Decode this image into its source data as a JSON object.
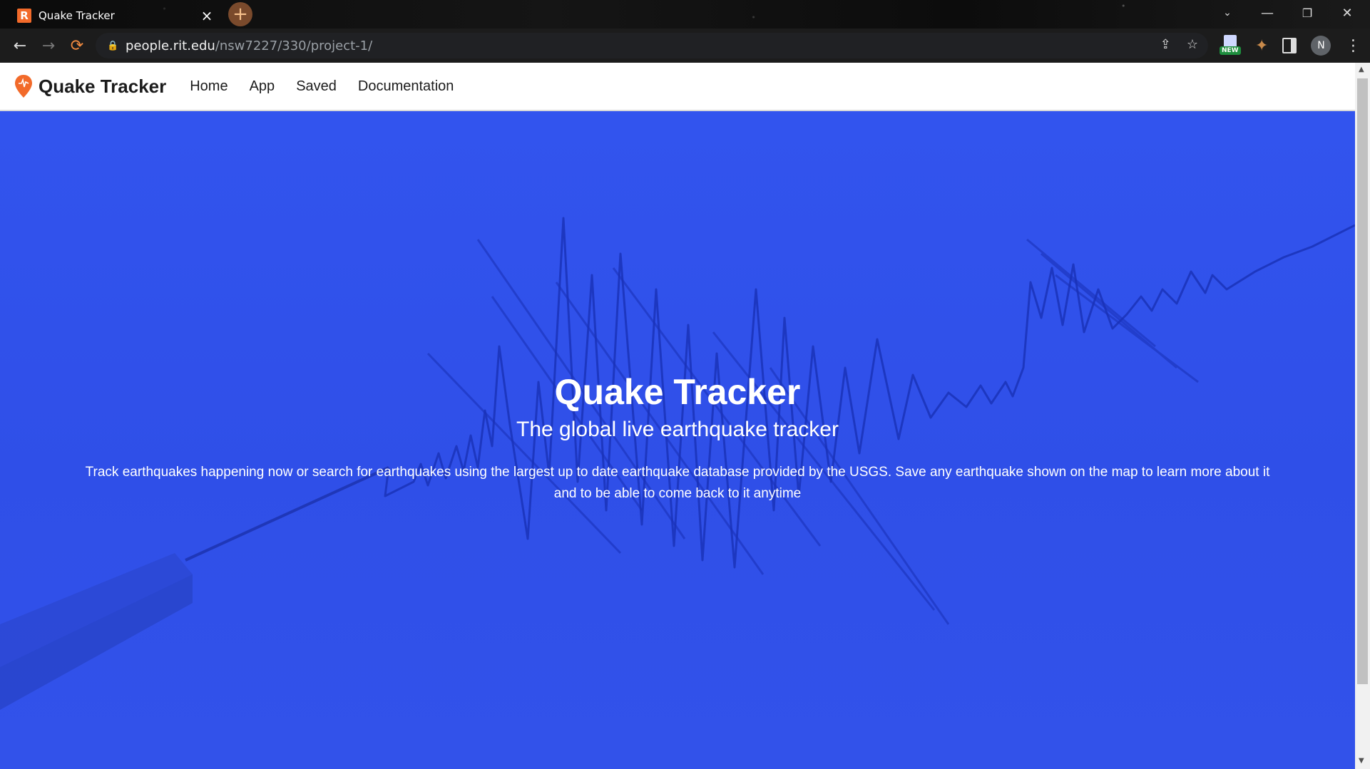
{
  "browser": {
    "tab_title": "Quake Tracker",
    "favicon_letter": "R",
    "url_host": "people.rit.edu",
    "url_path": "/nsw7227/330/project-1/",
    "ext_badge": "NEW",
    "profile_initial": "N"
  },
  "site": {
    "brand": "Quake Tracker",
    "nav": [
      {
        "label": "Home"
      },
      {
        "label": "App"
      },
      {
        "label": "Saved"
      },
      {
        "label": "Documentation"
      }
    ]
  },
  "hero": {
    "title": "Quake Tracker",
    "subtitle": "The global live earthquake tracker",
    "description": "Track earthquakes happening now or search for earthquakes using the largest up to date earthquake database provided by the USGS. Save any earthquake shown on the map to learn more about it and to be able to come back to it anytime"
  },
  "colors": {
    "hero_blue": "#3254ee",
    "brand_orange": "#f26a2a"
  }
}
